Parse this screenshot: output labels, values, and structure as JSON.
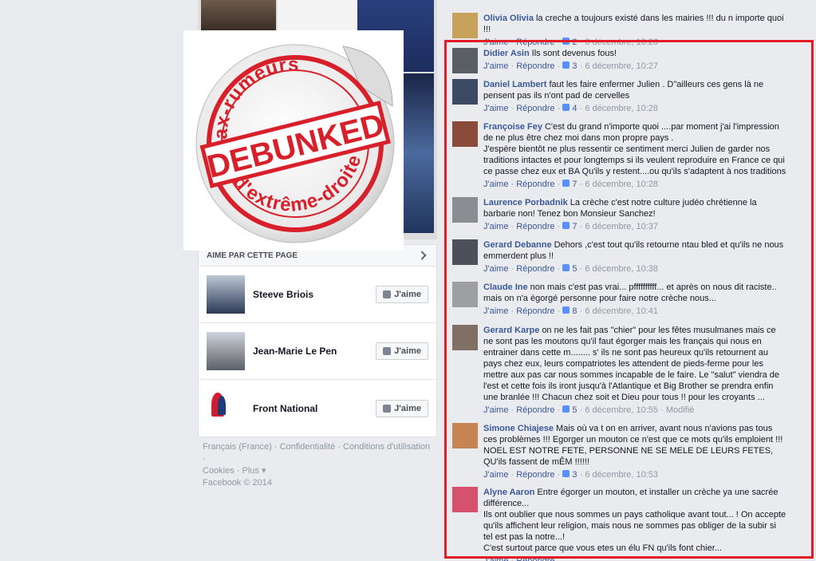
{
  "sticker": {
    "top_text": "Hoax-rumeurs",
    "center_text": "DEBUNKED",
    "bottom_text": "d'extrême-droite"
  },
  "sidebar": {
    "header": "AIME PAR CETTE PAGE",
    "like_label": "J'aime",
    "pages": [
      {
        "name": "Steeve Briois"
      },
      {
        "name": "Jean-Marie Le Pen"
      },
      {
        "name": "Front National"
      }
    ]
  },
  "footer": {
    "line1": "Français (France) · Confidentialité · Conditions d'utilisation ·",
    "line2": "Cookies · Plus ▾",
    "line3": "Facebook © 2014"
  },
  "comment_actions": {
    "like": "J'aime",
    "reply": "Répondre"
  },
  "comments": [
    {
      "author": "Olivia Olivia",
      "text": "la creche a toujours existé dans les mairies !!! du n importe quoi !!!",
      "likes": "2",
      "time": "6 décembre, 10:26",
      "edited": ""
    },
    {
      "author": "Didier Asin",
      "text": "Ils sont devenus fous!",
      "likes": "3",
      "time": "6 décembre, 10:27",
      "edited": ""
    },
    {
      "author": "Daniel Lambert",
      "text": "faut les faire enfermer Julien . D\"ailleurs ces gens là ne pensent pas ils n'ont pad de cervelles",
      "likes": "4",
      "time": "6 décembre, 10:28",
      "edited": ""
    },
    {
      "author": "Françoise Fey",
      "text": "C'est du grand n'importe quoi ....par moment j'ai l'impression de ne plus être chez moi dans mon propre pays .\nJ'espère bientôt ne plus ressentir ce sentiment merci Julien de garder nos traditions intactes et pour longtemps si ils veulent reproduire en France ce qui ce passe chez eux et BA Qu'ils y restent....ou qu'ils s'adaptent à nos traditions",
      "likes": "7",
      "time": "6 décembre, 10:28",
      "edited": ""
    },
    {
      "author": "Laurence Porbadnik",
      "text": "La crèche c'est notre culture judéo chrétienne la barbarie non! Tenez bon Monsieur Sanchez!",
      "likes": "7",
      "time": "6 décembre, 10:37",
      "edited": ""
    },
    {
      "author": "Gerard Debanne",
      "text": "Dehors ,c'est tout qu'ils retourne ntau bled et qu'ils ne nous emmerdent plus !!",
      "likes": "5",
      "time": "6 décembre, 10:38",
      "edited": ""
    },
    {
      "author": "Claude Ine",
      "text": "non mais c'est pas vrai... pffffffffff... et après on nous dit raciste.. mais on n'a égorgé personne pour faire notre crèche nous...",
      "likes": "8",
      "time": "6 décembre, 10:41",
      "edited": ""
    },
    {
      "author": "Gerard Karpe",
      "text": "on ne les fait pas \"chier\" pour les fêtes musulmanes mais ce ne sont pas les moutons qu'il faut égorger mais les français qui nous en entrainer dans cette m........ s' ils ne sont pas heureux qu'ils retournent au pays chez eux, leurs compatriotes les attendent de pieds-ferme pour les mettre aux pas car nous sommes incapable de le faire. Le \"salut\" viendra de l'est et cette fois ils iront jusqu'à l'Atlantique et Big Brother se prendra enfin une branlée !!! Chacun chez soit et Dieu pour tous !! pour les croyants ...",
      "likes": "5",
      "time": "6 décembre, 10:55",
      "edited": "Modifié"
    },
    {
      "author": "Simone Chiajese",
      "text": "Mais où va t on en arriver, avant nous n'avions pas tous ces problèmes !!! Egorger un mouton ce n'est que ce mots qu'ils emploient !!! NOEL EST NOTRE FETE, PERSONNE NE SE MELE DE LEURS FETES, QU'ils fassent de mÊM !!!!!!",
      "likes": "3",
      "time": "6 décembre, 10:53",
      "edited": ""
    },
    {
      "author": "Alyne Aaron",
      "text": "Entre égorger un mouton, et installer un crèche ya une sacrée différence...\nIls ont oublier que nous sommes un pays catholique avant tout... ! On accepte qu'ils affichent leur religion, mais nous ne sommes pas obliger de la subir si tel est pas la notre...!\nC'est surtout parce que vous etes un élu FN qu'ils font chier...",
      "likes": "",
      "time": "",
      "edited": ""
    }
  ],
  "colors": {
    "link": "#3b5998",
    "highlight_frame": "#e31b24",
    "sticker_red": "#d8202a"
  }
}
